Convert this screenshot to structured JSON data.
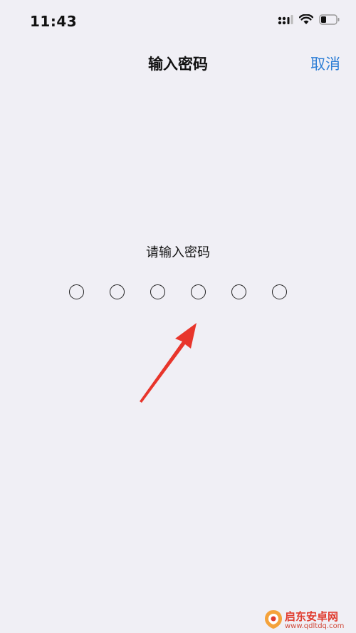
{
  "status_bar": {
    "time": "11:43",
    "icons": [
      "cellular-signal-icon",
      "wifi-icon",
      "battery-icon"
    ]
  },
  "nav": {
    "title": "输入密码",
    "cancel_label": "取消"
  },
  "passcode": {
    "prompt": "请输入密码",
    "digit_count": 6,
    "filled_count": 0
  },
  "annotation": {
    "arrow_color": "#e8352b"
  },
  "watermark": {
    "brand": "启东安卓网",
    "url": "www.qdltdq.com"
  },
  "colors": {
    "background": "#f0eff5",
    "accent": "#2f7fd6"
  }
}
